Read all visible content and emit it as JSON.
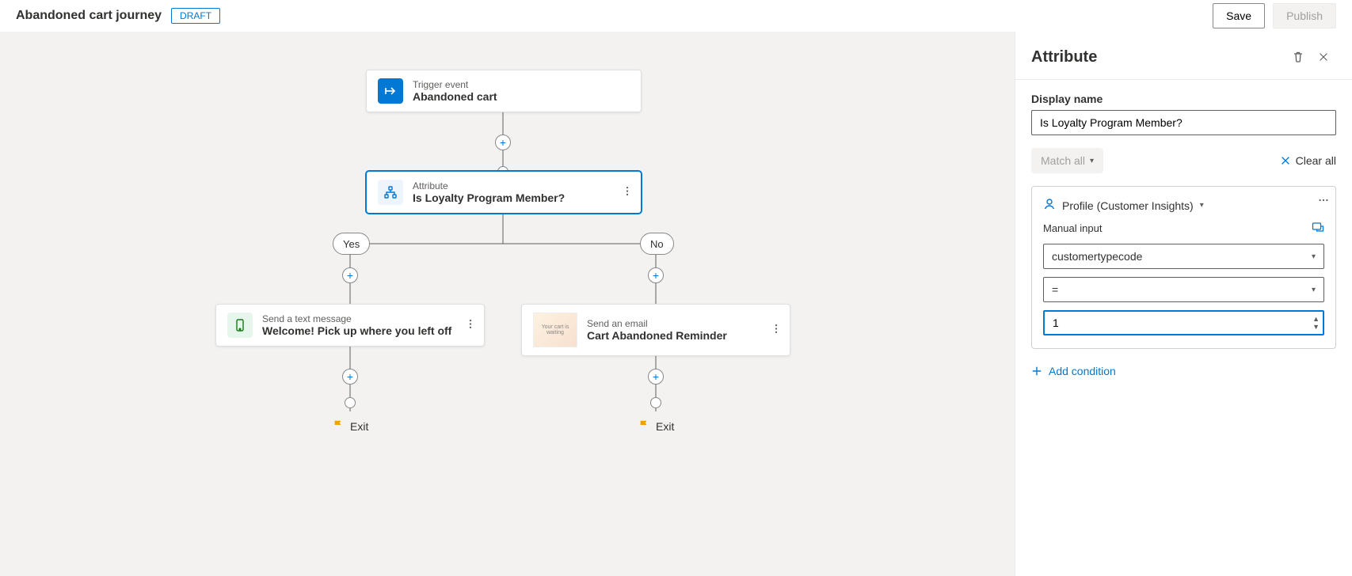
{
  "header": {
    "title": "Abandoned cart journey",
    "status": "DRAFT",
    "save": "Save",
    "publish": "Publish"
  },
  "canvas": {
    "trigger": {
      "overline": "Trigger event",
      "title": "Abandoned cart"
    },
    "attribute": {
      "overline": "Attribute",
      "title": "Is Loyalty Program Member?"
    },
    "branch_yes": "Yes",
    "branch_no": "No",
    "sms": {
      "overline": "Send a text message",
      "title": "Welcome! Pick up where you left off"
    },
    "email": {
      "overline": "Send an email",
      "title": "Cart Abandoned Reminder",
      "thumb_text": "Your cart is waiting"
    },
    "exit": "Exit"
  },
  "panel": {
    "title": "Attribute",
    "display_name_label": "Display name",
    "display_name_value": "Is Loyalty Program Member?",
    "match_all": "Match all",
    "clear_all": "Clear all",
    "profile_source": "Profile (Customer Insights)",
    "manual_input": "Manual input",
    "field": "customertypecode",
    "operator": "=",
    "value": "1",
    "add_condition": "Add condition"
  }
}
